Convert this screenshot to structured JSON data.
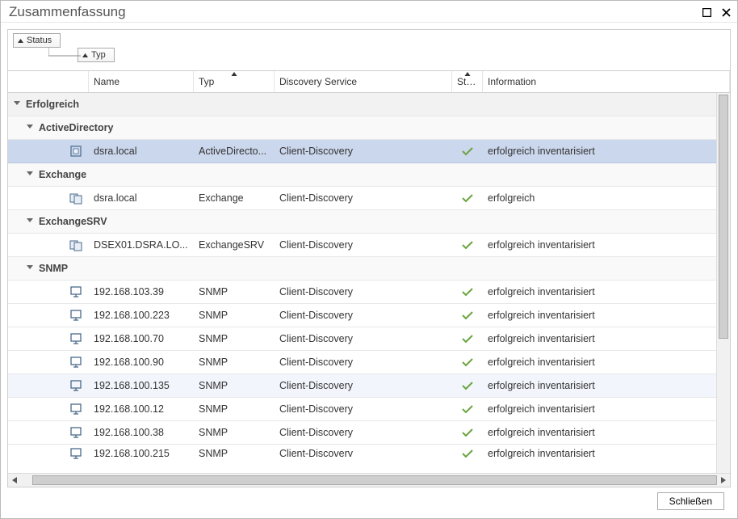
{
  "window": {
    "title": "Zusammenfassung"
  },
  "groupChips": {
    "status": "Status",
    "typ": "Typ"
  },
  "columns": {
    "name": "Name",
    "typ": "Typ",
    "discoveryService": "Discovery Service",
    "status": "Status",
    "information": "Information"
  },
  "groups": {
    "erfolgreich": "Erfolgreich",
    "activeDirectory": "ActiveDirectory",
    "exchange": "Exchange",
    "exchangeSRV": "ExchangeSRV",
    "snmp": "SNMP"
  },
  "rows": {
    "ad0": {
      "name": "dsra.local",
      "type": "ActiveDirecto...",
      "ds": "Client-Discovery",
      "info": "erfolgreich inventarisiert"
    },
    "ex0": {
      "name": "dsra.local",
      "type": "Exchange",
      "ds": "Client-Discovery",
      "info": "erfolgreich"
    },
    "exs0": {
      "name": "DSEX01.DSRA.LO...",
      "type": "ExchangeSRV",
      "ds": "Client-Discovery",
      "info": "erfolgreich inventarisiert"
    },
    "sn0": {
      "name": "192.168.103.39",
      "type": "SNMP",
      "ds": "Client-Discovery",
      "info": "erfolgreich inventarisiert"
    },
    "sn1": {
      "name": "192.168.100.223",
      "type": "SNMP",
      "ds": "Client-Discovery",
      "info": "erfolgreich inventarisiert"
    },
    "sn2": {
      "name": "192.168.100.70",
      "type": "SNMP",
      "ds": "Client-Discovery",
      "info": "erfolgreich inventarisiert"
    },
    "sn3": {
      "name": "192.168.100.90",
      "type": "SNMP",
      "ds": "Client-Discovery",
      "info": "erfolgreich inventarisiert"
    },
    "sn4": {
      "name": "192.168.100.135",
      "type": "SNMP",
      "ds": "Client-Discovery",
      "info": "erfolgreich inventarisiert"
    },
    "sn5": {
      "name": "192.168.100.12",
      "type": "SNMP",
      "ds": "Client-Discovery",
      "info": "erfolgreich inventarisiert"
    },
    "sn6": {
      "name": "192.168.100.38",
      "type": "SNMP",
      "ds": "Client-Discovery",
      "info": "erfolgreich inventarisiert"
    },
    "sn7": {
      "name": "192.168.100.215",
      "type": "SNMP",
      "ds": "Client-Discoverv",
      "info": "erfolgreich inventarisiert"
    }
  },
  "footer": {
    "close": "Schließen"
  }
}
